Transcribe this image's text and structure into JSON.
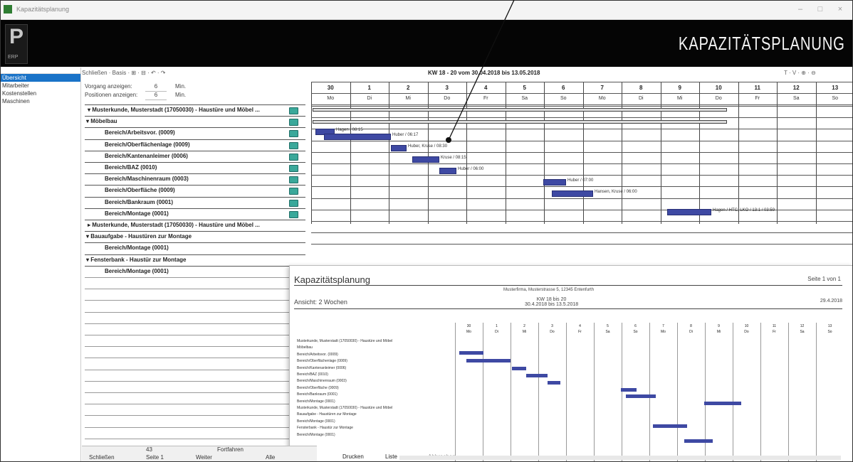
{
  "window": {
    "title": "Kapazitätsplanung",
    "buttons": [
      "–",
      "□",
      "×"
    ]
  },
  "banner": {
    "logo_letter": "P",
    "logo_sub": "ERP",
    "brand": "KAPAZITÄTSPLANUNG"
  },
  "sidebar": {
    "items": [
      {
        "label": "Übersicht",
        "active": true
      },
      {
        "label": "Mitarbeiter",
        "active": false
      },
      {
        "label": "Kostenstellen",
        "active": false
      },
      {
        "label": "Maschinen",
        "active": false
      }
    ]
  },
  "toolbar": {
    "label": "Schließen · Basis · ⊞ · ⊟ · ↶ · ↷"
  },
  "options": {
    "row1_label": "Vorgang anzeigen:",
    "row1_value": "6",
    "row1_unit": "Min.",
    "row2_label": "Positionen anzeigen:",
    "row2_value": "6",
    "row2_unit": "Min."
  },
  "header": {
    "title": "KW 18 - 20 vom 30.04.2018 bis 13.05.2018",
    "icons": "T · V · ⊕ · ⊖"
  },
  "left_rows": [
    {
      "text": "▾ Musterkunde, Musterstadt (17050030) - Haustüre und Möbel ...",
      "type": "header"
    },
    {
      "text": "▾ Möbelbau",
      "type": "sub"
    },
    {
      "text": "Bereich/Arbeitsvor. (0009)",
      "type": "indent"
    },
    {
      "text": "Bereich/Oberflächenlage (0009)",
      "type": "indent"
    },
    {
      "text": "Bereich/Kantenanleimer (0006)",
      "type": "indent"
    },
    {
      "text": "Bereich/BAZ (0010)",
      "type": "indent"
    },
    {
      "text": "Bereich/Maschinenraum (0003)",
      "type": "indent"
    },
    {
      "text": "Bereich/Oberfläche (0009)",
      "type": "indent"
    },
    {
      "text": "Bereich/Bankraum (0001)",
      "type": "indent"
    },
    {
      "text": "Bereich/Montage (0001)",
      "type": "indent"
    },
    {
      "text": "▸ Musterkunde, Musterstadt (17050030) - Haustüre und Möbel ...",
      "type": "header"
    },
    {
      "text": "▾ Bauaufgabe - Haustüren zur Montage",
      "type": "sub"
    },
    {
      "text": "Bereich/Montage (0001)",
      "type": "indent"
    },
    {
      "text": "▾ Fensterbank - Haustür zur Montage",
      "type": "sub"
    },
    {
      "text": "Bereich/Montage (0001)",
      "type": "indent"
    }
  ],
  "gantt": {
    "days": [
      "30",
      "1",
      "2",
      "3",
      "4",
      "5",
      "6",
      "7",
      "8",
      "9",
      "10",
      "11",
      "12",
      "13"
    ],
    "weekdays": [
      "Mo",
      "Di",
      "Mi",
      "Do",
      "Fr",
      "Sa",
      "So",
      "Mo",
      "Di",
      "Mi",
      "Do",
      "Fr",
      "Sa",
      "So"
    ],
    "bars": [
      {
        "label": "Hagen / 08:15"
      },
      {
        "label": "Huber / 06:17"
      },
      {
        "label": "Huber, Kruse / 08:30"
      },
      {
        "label": "Kruse / 08:15"
      },
      {
        "label": "Huber / 06:00"
      },
      {
        "label": "Huber / 07:00"
      },
      {
        "label": "Hansen, Kruse / 06:00"
      },
      {
        "label": "Hagen / HTC, LKO / 13:1 / 03:59"
      }
    ]
  },
  "preview": {
    "title": "Kapazitätsplanung",
    "page": "Seite 1 von 1",
    "company": "Musterfirma, Musterstrasse 5, 12345 Entenfurth",
    "view": "Ansicht: 2 Wochen",
    "kw": "KW 18 bis 20",
    "range": "30.4.2018 bis 13.5.2018",
    "date": "29.4.2018",
    "rows": [
      "Musterkunde, Musterstadt (17050030) - Haustüre und Möbel",
      "Möbelbau",
      "Bereich/Arbeitsvor. (0009)",
      "Bereich/Oberflächenlage (0009)",
      "Bereich/Kantenanleimer (0006)",
      "Bereich/BAZ (0010)",
      "Bereich/Maschinenraum (0003)",
      "Bereich/Oberfläche (0009)",
      "Bereich/Bankraum (0001)",
      "Bereich/Montage (0001)",
      "Musterkunde, Musterstadt (17050030) - Haustüre und Möbel",
      "Bauaufgabe - Haustüren zur Montage",
      "Bereich/Montage (0001)",
      "Fensterbank - Haustür zur Montage",
      "Bereich/Montage (0001)"
    ]
  },
  "statusbar": {
    "zoom": "43",
    "fit": "Fortfahren",
    "tabs": [
      "Schließen",
      "Seite 1",
      "Weiter",
      "Alle",
      "Drucken",
      "Liste",
      "Abbrechen"
    ]
  }
}
